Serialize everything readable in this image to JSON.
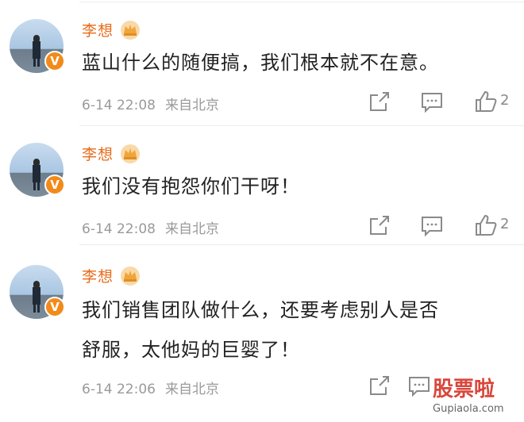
{
  "comments": [
    {
      "username": "李想",
      "verified_badge": "V",
      "text_lines": [
        "蓝山什么的随便搞，我们根本就不在意。"
      ],
      "time": "6-14 22:08",
      "source": "来自北京",
      "likes": "2"
    },
    {
      "username": "李想",
      "verified_badge": "V",
      "text_lines": [
        "我们没有抱怨你们干呀！"
      ],
      "time": "6-14 22:08",
      "source": "来自北京",
      "likes": "2"
    },
    {
      "username": "李想",
      "verified_badge": "V",
      "text_lines": [
        "我们销售团队做什么，还要考虑别人是否",
        "舒服，太他妈的巨婴了！"
      ],
      "time": "6-14 22:06",
      "source": "来自北京",
      "likes": ""
    }
  ],
  "icons": [
    "crown-icon",
    "share-icon",
    "comment-icon",
    "like-icon"
  ],
  "colors": {
    "username": "#e86b1a",
    "badge": "#f28a1a",
    "meta": "#9a9a9a",
    "watermark": "#d9463b"
  },
  "watermark": {
    "title": "股票啦",
    "subtitle": "Gupiaola.com"
  }
}
